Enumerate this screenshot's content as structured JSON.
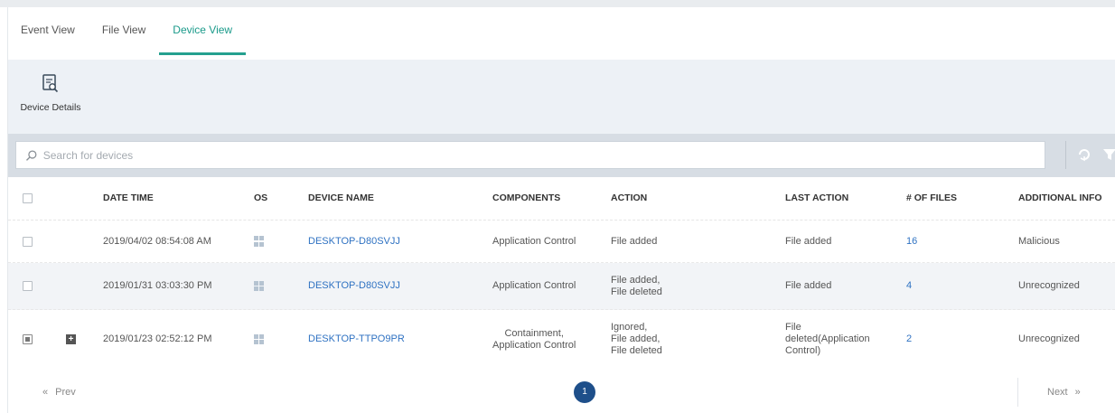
{
  "tabs": [
    {
      "label": "Event View"
    },
    {
      "label": "File View"
    },
    {
      "label": "Device View"
    }
  ],
  "toolbar": {
    "device_details_label": "Device Details"
  },
  "search": {
    "placeholder": "Search for devices"
  },
  "table": {
    "headers": {
      "date_time": "DATE TIME",
      "os": "OS",
      "device_name": "DEVICE NAME",
      "components": "COMPONENTS",
      "action": "ACTION",
      "last_action": "LAST ACTION",
      "num_files": "# OF FILES",
      "additional_info": "ADDITIONAL INFO"
    },
    "rows": [
      {
        "date_time": "2019/04/02 08:54:08 AM",
        "device_name": "DESKTOP-D80SVJJ",
        "components": [
          "Application Control"
        ],
        "action": [
          "File added"
        ],
        "last_action": [
          "File added"
        ],
        "num_files": "16",
        "additional_info": "Malicious"
      },
      {
        "date_time": "2019/01/31 03:03:30 PM",
        "device_name": "DESKTOP-D80SVJJ",
        "components": [
          "Application Control"
        ],
        "action": [
          "File added,",
          "File deleted"
        ],
        "last_action": [
          "File added"
        ],
        "num_files": "4",
        "additional_info": "Unrecognized"
      },
      {
        "date_time": "2019/01/23 02:52:12 PM",
        "device_name": "DESKTOP-TTPO9PR",
        "components": [
          "Containment,",
          "Application Control"
        ],
        "action": [
          "Ignored,",
          "File added,",
          "File deleted"
        ],
        "last_action": [
          "File",
          "deleted(Application",
          "Control)"
        ],
        "num_files": "2",
        "additional_info": "Unrecognized"
      }
    ]
  },
  "pagination": {
    "prev_label": "Prev",
    "current_page": "1",
    "next_label": "Next"
  },
  "colors": {
    "accent": "#25a08f",
    "link": "#2f72c2",
    "page_bubble": "#1e4f8a"
  }
}
